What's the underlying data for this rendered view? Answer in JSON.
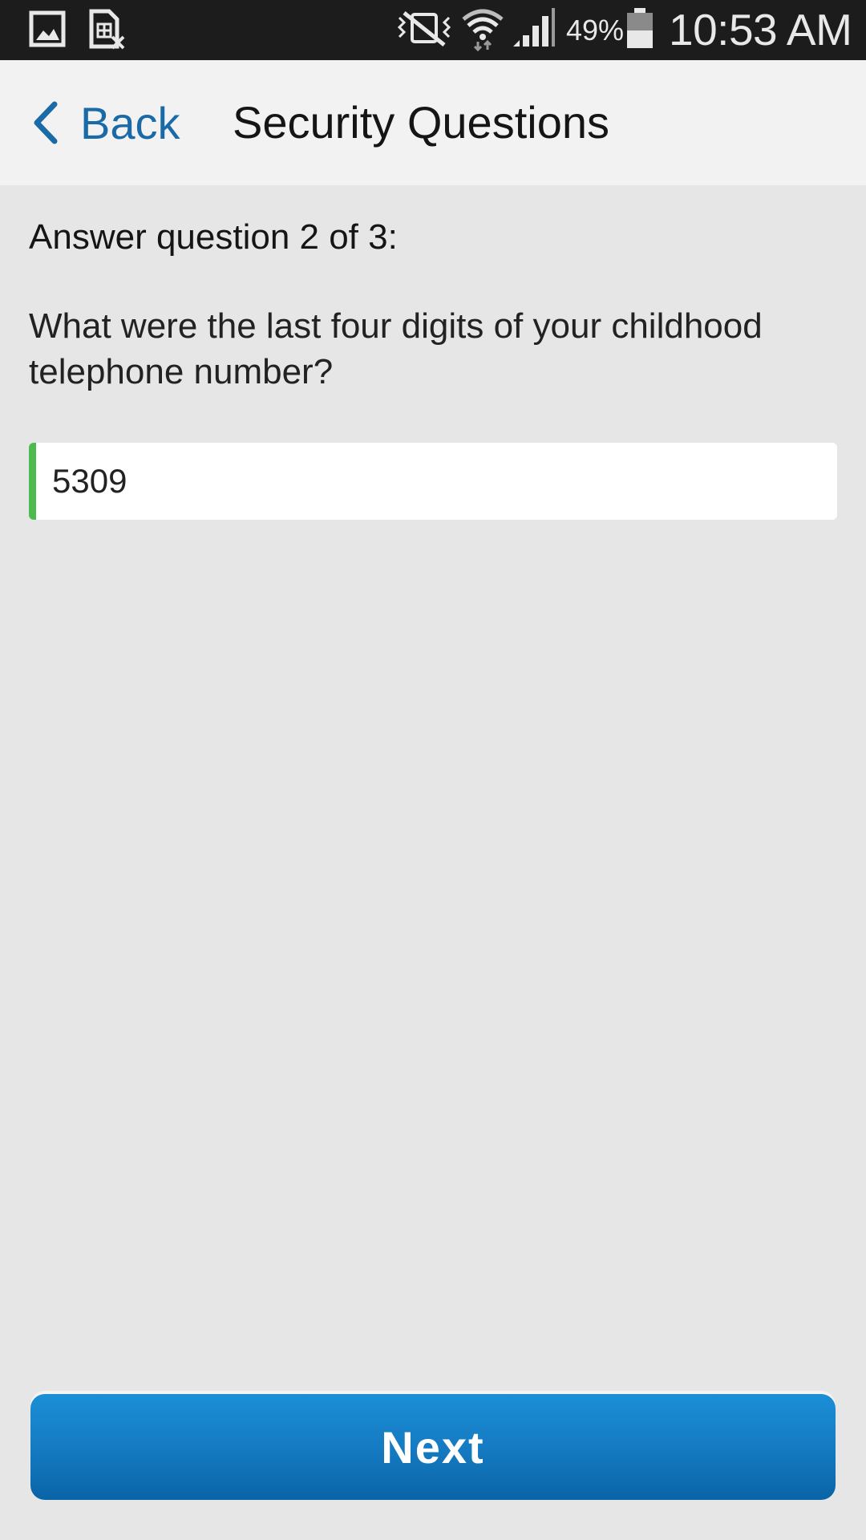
{
  "status_bar": {
    "battery_percent": "49%",
    "battery_level": 0.49,
    "time": "10:53 AM",
    "icons": [
      "image-icon",
      "sim-card-icon",
      "vibrate-mute-icon",
      "wifi-icon",
      "signal-icon",
      "battery-icon"
    ]
  },
  "nav": {
    "back_label": "Back",
    "title": "Security Questions"
  },
  "question": {
    "count_label": "Answer question 2 of 3:",
    "current": 2,
    "total": 3,
    "text": "What were the last four digits of your childhood telephone number?"
  },
  "answer": {
    "value": "5309",
    "valid_color": "#4cba4c"
  },
  "actions": {
    "next_label": "Next"
  },
  "colors": {
    "accent": "#1b6aa8",
    "button": "#1479c0",
    "background": "#e6e6e7",
    "nav_background": "#f2f2f2"
  }
}
